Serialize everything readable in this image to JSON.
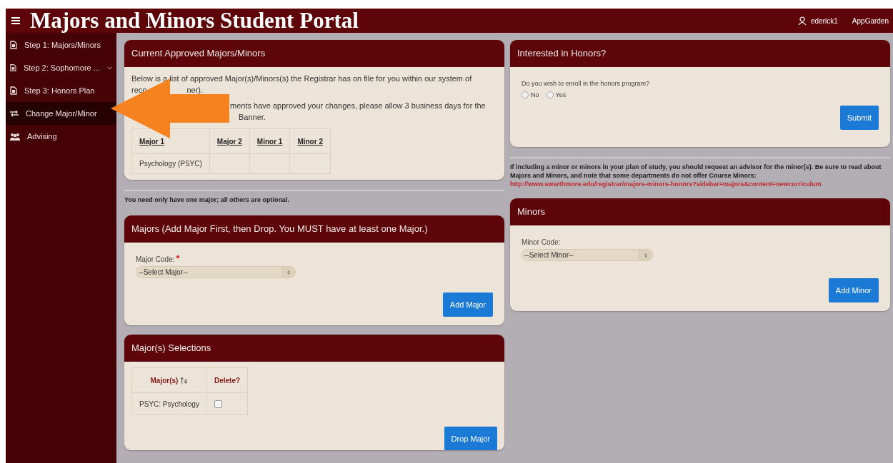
{
  "header": {
    "title": "Majors and Minors Student Portal",
    "user": "ederick1",
    "app_link": "AppGarden"
  },
  "sidebar": {
    "items": [
      {
        "label": "Step 1: Majors/Minors",
        "selected": false,
        "has_submenu": false
      },
      {
        "label": "Step 2: Sophomore ...",
        "selected": false,
        "has_submenu": true
      },
      {
        "label": "Step 3: Honors Plan",
        "selected": false,
        "has_submenu": false
      },
      {
        "label": "Change Major/Minor",
        "selected": true,
        "has_submenu": false
      },
      {
        "label": "Advising",
        "selected": false,
        "has_submenu": false
      }
    ]
  },
  "current_card": {
    "title": "Current Approved Majors/Minors",
    "line_1": "Below is a list of approved Major(s)/Minors(s) the Registrar has on file for you within our system of",
    "line_2_start": "reco",
    "line_2_end": "ner).",
    "line_3": "ments have approved your changes, please allow 3 business days for the",
    "line_4": "Banner.",
    "table": {
      "columns": [
        "Major 1",
        "Major 2",
        "Minor 1",
        "Minor 2"
      ],
      "rows": [
        [
          "Psychology (PSYC)",
          "",
          "",
          ""
        ]
      ]
    }
  },
  "honors_card": {
    "title": "Interested in Honors?",
    "question": "Do you wish to enroll in the honors program?",
    "options": [
      {
        "label": "No",
        "selected": false
      },
      {
        "label": "Yes",
        "selected": false
      }
    ],
    "button": "Submit"
  },
  "majors_note": "You need only have one major; all others are optional.",
  "minors_note": "If including a minor or minors in your plan of study, you should request an advisor for the minor(s). Be sure to read about Majors and Minors, and note that some departments do not offer Course Minors:",
  "minors_link": "http://www.swarthmore.edu/registrar/majors-minors-honors?sidebar=majors&content=newcurriculum",
  "majors_card": {
    "title": "Majors (Add Major First, then Drop. You MUST have at least one Major.)",
    "field_label": "Major Code:",
    "required": true,
    "value": "--Select Major--",
    "button": "Add Major"
  },
  "minors_card": {
    "title": "Minors",
    "field_label": "Minor Code:",
    "required": false,
    "value": "--Select Minor--",
    "button": "Add Minor"
  },
  "selections_card": {
    "title": "Major(s) Selections",
    "columns": [
      "Major(s)",
      "Delete?"
    ],
    "rows": [
      {
        "major": "PSYC: Psychology",
        "checked": false
      }
    ],
    "button": "Drop Major"
  }
}
